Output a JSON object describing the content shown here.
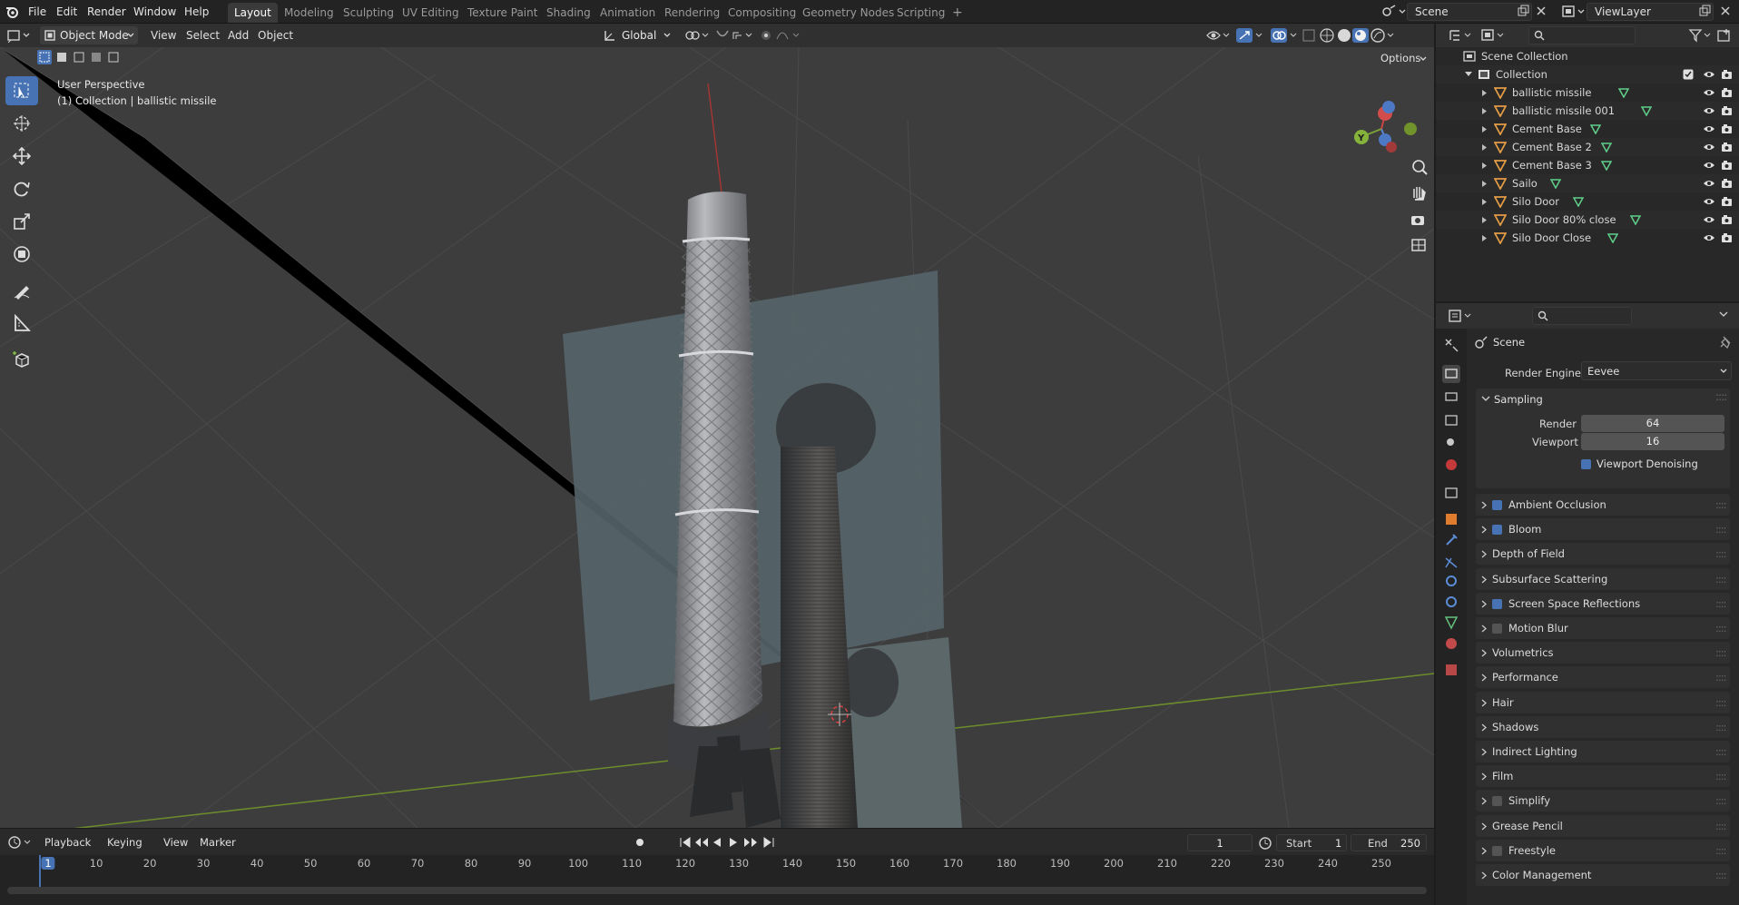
{
  "topbar": {
    "menus": [
      "File",
      "Edit",
      "Render",
      "Window",
      "Help"
    ],
    "workspaces": [
      {
        "label": "Layout",
        "active": true
      },
      {
        "label": "Modeling",
        "active": false
      },
      {
        "label": "Sculpting",
        "active": false
      },
      {
        "label": "UV Editing",
        "active": false
      },
      {
        "label": "Texture Paint",
        "active": false
      },
      {
        "label": "Shading",
        "active": false
      },
      {
        "label": "Animation",
        "active": false
      },
      {
        "label": "Rendering",
        "active": false
      },
      {
        "label": "Compositing",
        "active": false
      },
      {
        "label": "Geometry Nodes",
        "active": false
      },
      {
        "label": "Scripting",
        "active": false
      }
    ],
    "add_workspace": "+",
    "scene_name": "Scene",
    "view_layer_name": "ViewLayer"
  },
  "viewport_header": {
    "mode": "Object Mode",
    "menus": [
      "View",
      "Select",
      "Add",
      "Object"
    ],
    "transform_orientation": "Global",
    "options_label": "Options"
  },
  "viewport": {
    "perspective_label": "User Perspective",
    "context_label": "(1) Collection | ballistic missile",
    "gizmo_axes": {
      "x": "X",
      "y": "Y",
      "z": "Z"
    },
    "colors": {
      "background": "#3d3d3d",
      "grid": "#4a4a4a",
      "x_axis": "#8a3a3a",
      "y_axis": "#6d8d2c",
      "active_tool": "#4772b3"
    }
  },
  "toolbar": {
    "tools": [
      "select-box-icon",
      "cursor-icon",
      "move-icon",
      "rotate-icon",
      "scale-icon",
      "transform-icon",
      "annotate-icon",
      "measure-icon",
      "add-cube-icon"
    ]
  },
  "outliner": {
    "root": "Scene Collection",
    "collection": "Collection",
    "items": [
      "ballistic missile",
      "ballistic missile 001",
      "Cement  Base",
      "Cement  Base 2",
      "Cement  Base 3",
      "Sailo",
      "Silo Door",
      "Silo Door 80% close",
      "Silo Door Close"
    ]
  },
  "properties": {
    "context": "Scene",
    "render_engine_label": "Render Engine",
    "render_engine": "Eevee",
    "sampling": {
      "title": "Sampling",
      "render_label": "Render",
      "render_value": "64",
      "viewport_label": "Viewport",
      "viewport_value": "16",
      "denoise_label": "Viewport Denoising",
      "denoise_checked": true
    },
    "panels": [
      {
        "label": "Ambient Occlusion",
        "checkbox": true,
        "checked": true
      },
      {
        "label": "Bloom",
        "checkbox": true,
        "checked": true
      },
      {
        "label": "Depth of Field",
        "checkbox": false,
        "checked": false
      },
      {
        "label": "Subsurface Scattering",
        "checkbox": false,
        "checked": false
      },
      {
        "label": "Screen Space Reflections",
        "checkbox": true,
        "checked": true
      },
      {
        "label": "Motion Blur",
        "checkbox": true,
        "checked": false
      },
      {
        "label": "Volumetrics",
        "checkbox": false,
        "checked": false
      },
      {
        "label": "Performance",
        "checkbox": false,
        "checked": false
      },
      {
        "label": "Hair",
        "checkbox": false,
        "checked": false
      },
      {
        "label": "Shadows",
        "checkbox": false,
        "checked": false
      },
      {
        "label": "Indirect Lighting",
        "checkbox": false,
        "checked": false
      },
      {
        "label": "Film",
        "checkbox": false,
        "checked": false
      },
      {
        "label": "Simplify",
        "checkbox": true,
        "checked": false
      },
      {
        "label": "Grease Pencil",
        "checkbox": false,
        "checked": false
      },
      {
        "label": "Freestyle",
        "checkbox": true,
        "checked": false
      },
      {
        "label": "Color Management",
        "checkbox": false,
        "checked": false
      }
    ]
  },
  "timeline": {
    "menus": [
      "Playback",
      "Keying",
      "View",
      "Marker"
    ],
    "current_frame": "1",
    "start_label": "Start",
    "start_value": "1",
    "end_label": "End",
    "end_value": "250",
    "ticks": [
      "1",
      "10",
      "20",
      "30",
      "40",
      "50",
      "60",
      "70",
      "80",
      "90",
      "100",
      "110",
      "120",
      "130",
      "140",
      "150",
      "160",
      "170",
      "180",
      "190",
      "200",
      "210",
      "220",
      "230",
      "240",
      "250"
    ]
  }
}
